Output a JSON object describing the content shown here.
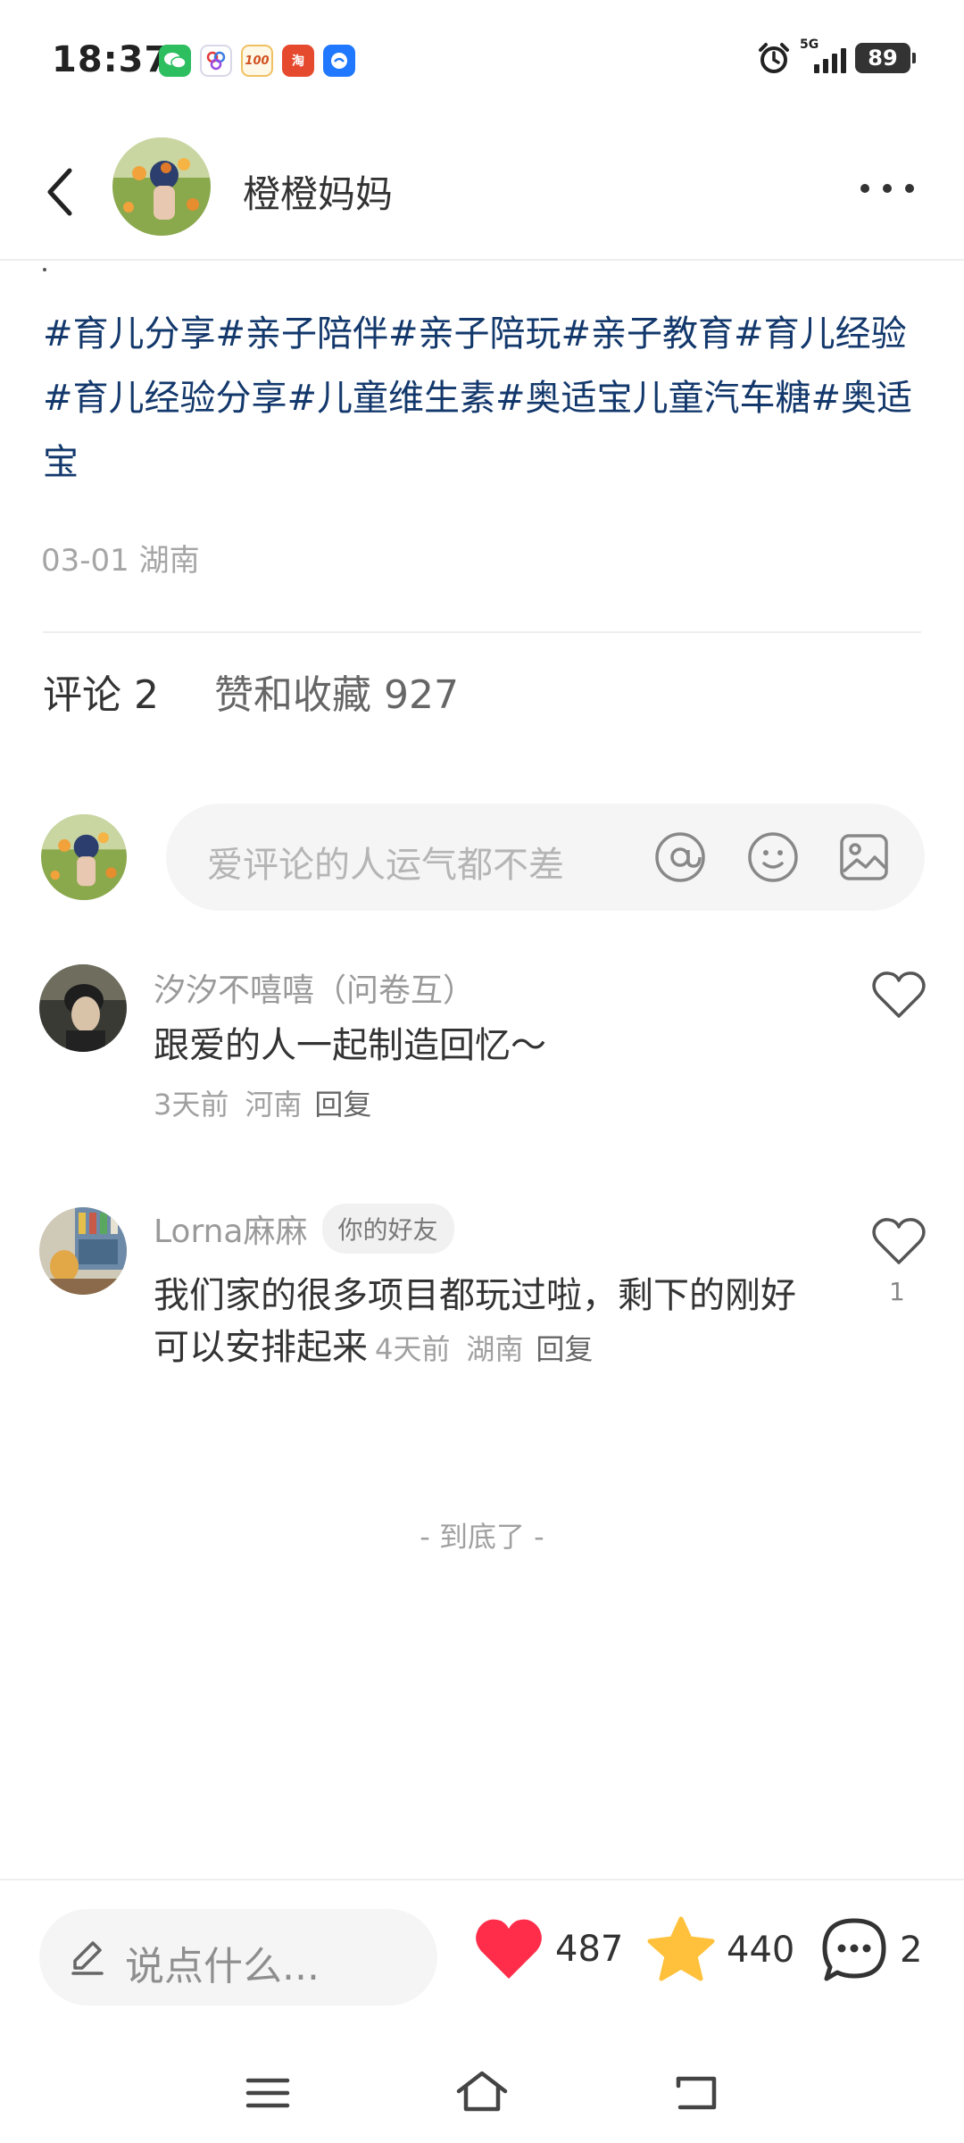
{
  "status_bar": {
    "time": "18:37",
    "notification_icons": [
      "wechat-icon",
      "baidu-icon",
      "hundred-icon",
      "taobao-icon",
      "message-app-icon"
    ],
    "hundred_label": "100",
    "taobao_label": "淘",
    "network": "5G",
    "battery": "89"
  },
  "header": {
    "author": "橙橙妈妈"
  },
  "post": {
    "hashtags": "#育儿分享#亲子陪伴#亲子陪玩#亲子教育#育儿经验#育儿经验分享#儿童维生素#奥适宝儿童汽车糖#奥适宝",
    "date": "03-01",
    "location": "湖南"
  },
  "tabs": {
    "comments": "评论 2",
    "likes_favorites": "赞和收藏 927"
  },
  "comment_input": {
    "placeholder": "爱评论的人运气都不差"
  },
  "comments": [
    {
      "name": "汐汐不嘻嘻（问卷互）",
      "text": "跟爱的人一起制造回忆～",
      "time": "3天前",
      "location": "河南",
      "reply": "回复",
      "likes": ""
    },
    {
      "name": "Lorna麻麻",
      "badge": "你的好友",
      "text": "我们家的很多项目都玩过啦，剩下的刚好可以安排起来",
      "time": "4天前",
      "location": "湖南",
      "reply": "回复",
      "likes": "1"
    }
  ],
  "end_text": "- 到底了 -",
  "bottom_bar": {
    "say_placeholder": "说点什么...",
    "likes": "487",
    "favorites": "440",
    "comments": "2",
    "colors": {
      "like": "#ff2d4a",
      "favorite": "#ffc13b"
    }
  }
}
